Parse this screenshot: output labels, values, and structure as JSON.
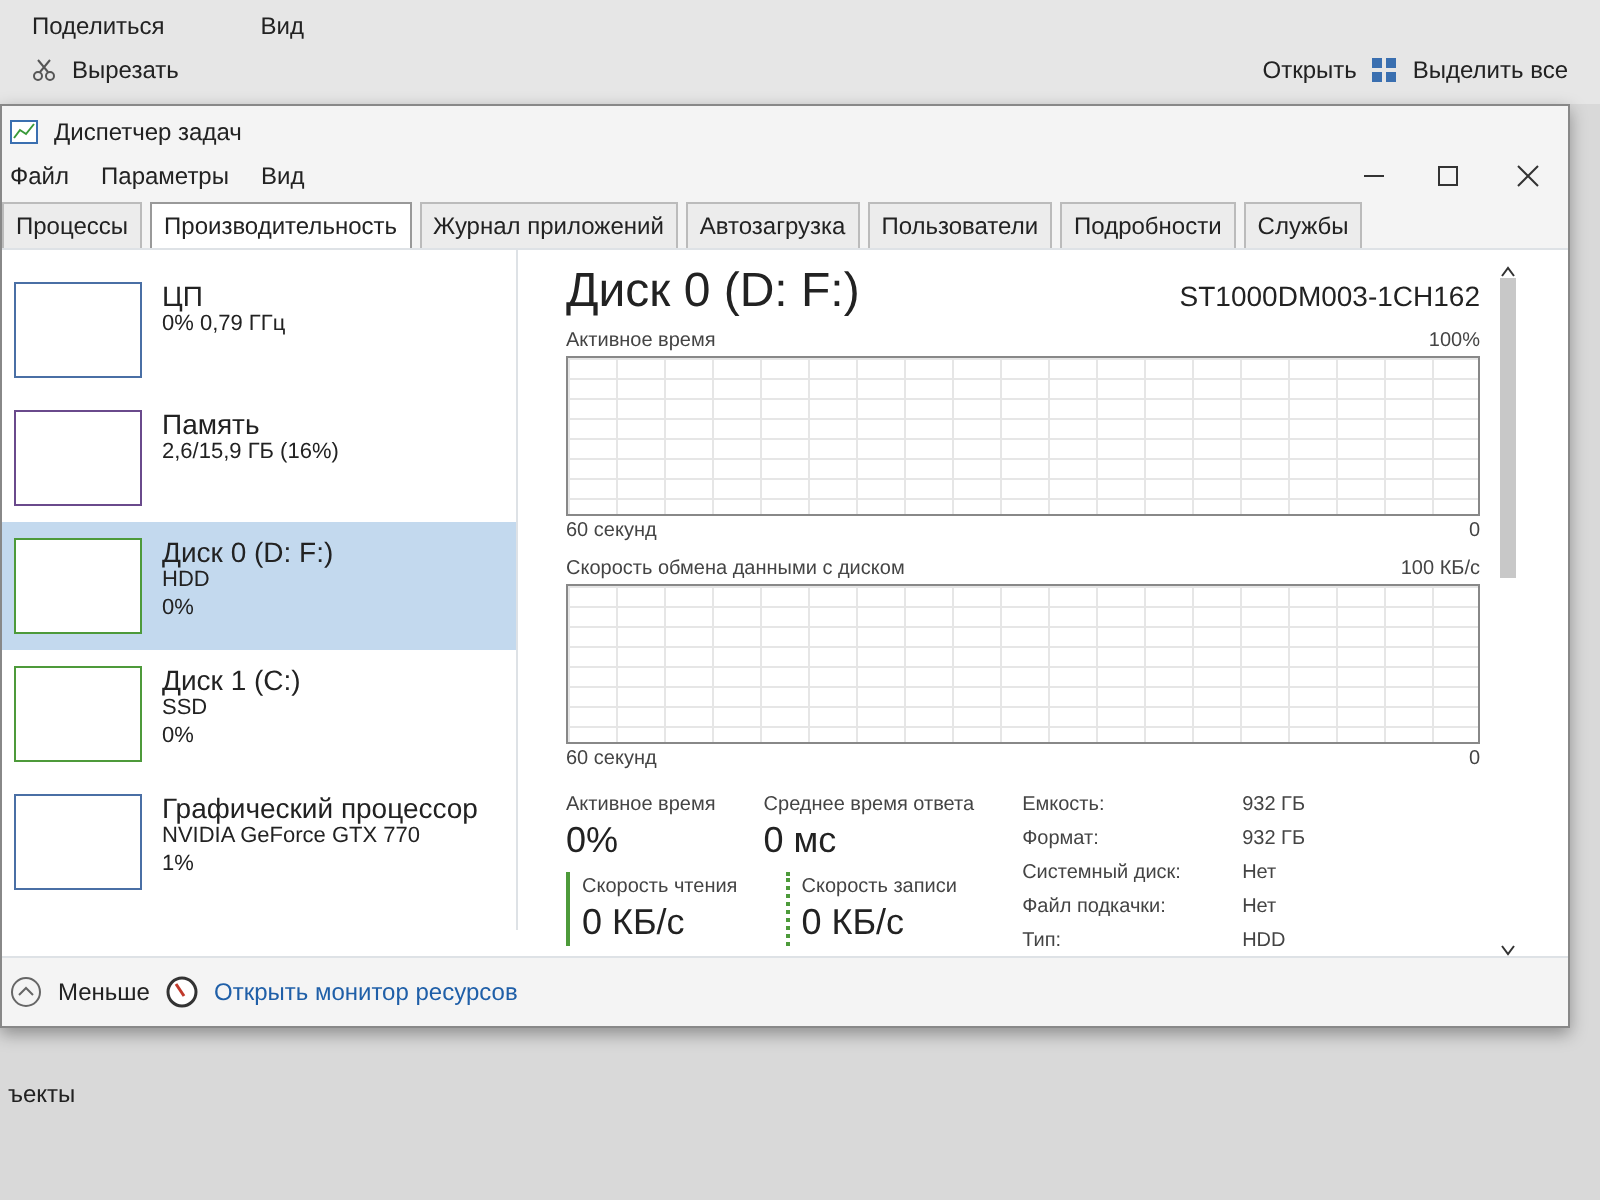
{
  "background_window": {
    "menu": [
      "Поделиться",
      "Вид"
    ],
    "toolbar": {
      "cut": "Вырезать",
      "open": "Открыть",
      "select_all": "Выделить все"
    },
    "status_text": "ъекты"
  },
  "window": {
    "title": "Диспетчер задач"
  },
  "menu": [
    "Файл",
    "Параметры",
    "Вид"
  ],
  "tabs": [
    {
      "label": "Процессы",
      "selected": false
    },
    {
      "label": "Производительность",
      "selected": true
    },
    {
      "label": "Журнал приложений",
      "selected": false
    },
    {
      "label": "Автозагрузка",
      "selected": false
    },
    {
      "label": "Пользователи",
      "selected": false
    },
    {
      "label": "Подробности",
      "selected": false
    },
    {
      "label": "Службы",
      "selected": false
    }
  ],
  "sidebar": {
    "items": [
      {
        "name": "ЦП",
        "details": [
          "0% 0,79 ГГц"
        ],
        "color": "#4a6fa5",
        "selected": false
      },
      {
        "name": "Память",
        "details": [
          "2,6/15,9 ГБ (16%)"
        ],
        "color": "#6a4a8c",
        "selected": false
      },
      {
        "name": "Диск 0 (D: F:)",
        "details": [
          "HDD",
          "0%"
        ],
        "color": "#4d9a3a",
        "selected": true
      },
      {
        "name": "Диск 1 (C:)",
        "details": [
          "SSD",
          "0%"
        ],
        "color": "#4d9a3a",
        "selected": false
      },
      {
        "name": "Графический процессор",
        "details": [
          "NVIDIA GeForce GTX 770",
          "1%"
        ],
        "color": "#4a6fa5",
        "selected": false
      }
    ]
  },
  "detail": {
    "title": "Диск 0 (D: F:)",
    "model": "ST1000DM003-1CH162",
    "graphs": [
      {
        "label": "Активное время",
        "max": "100%",
        "duration": "60 секунд",
        "min": "0"
      },
      {
        "label": "Скорость обмена данными с диском",
        "max": "100 КБ/с",
        "duration": "60 секунд",
        "min": "0"
      }
    ],
    "stats": [
      {
        "label": "Активное время",
        "value": "0%"
      },
      {
        "label": "Среднее время ответа",
        "value": "0 мс"
      }
    ],
    "speeds": [
      {
        "label": "Скорость чтения",
        "value": "0 КБ/с",
        "kind": "solid"
      },
      {
        "label": "Скорость записи",
        "value": "0 КБ/с",
        "kind": "dotted"
      }
    ],
    "properties": [
      {
        "label": "Емкость:",
        "value": "932 ГБ"
      },
      {
        "label": "Формат:",
        "value": "932 ГБ"
      },
      {
        "label": "Системный диск:",
        "value": "Нет"
      },
      {
        "label": "Файл подкачки:",
        "value": "Нет"
      },
      {
        "label": "Тип:",
        "value": "HDD"
      }
    ]
  },
  "footer": {
    "fewer": "Меньше",
    "resource_monitor": "Открыть монитор ресурсов"
  }
}
